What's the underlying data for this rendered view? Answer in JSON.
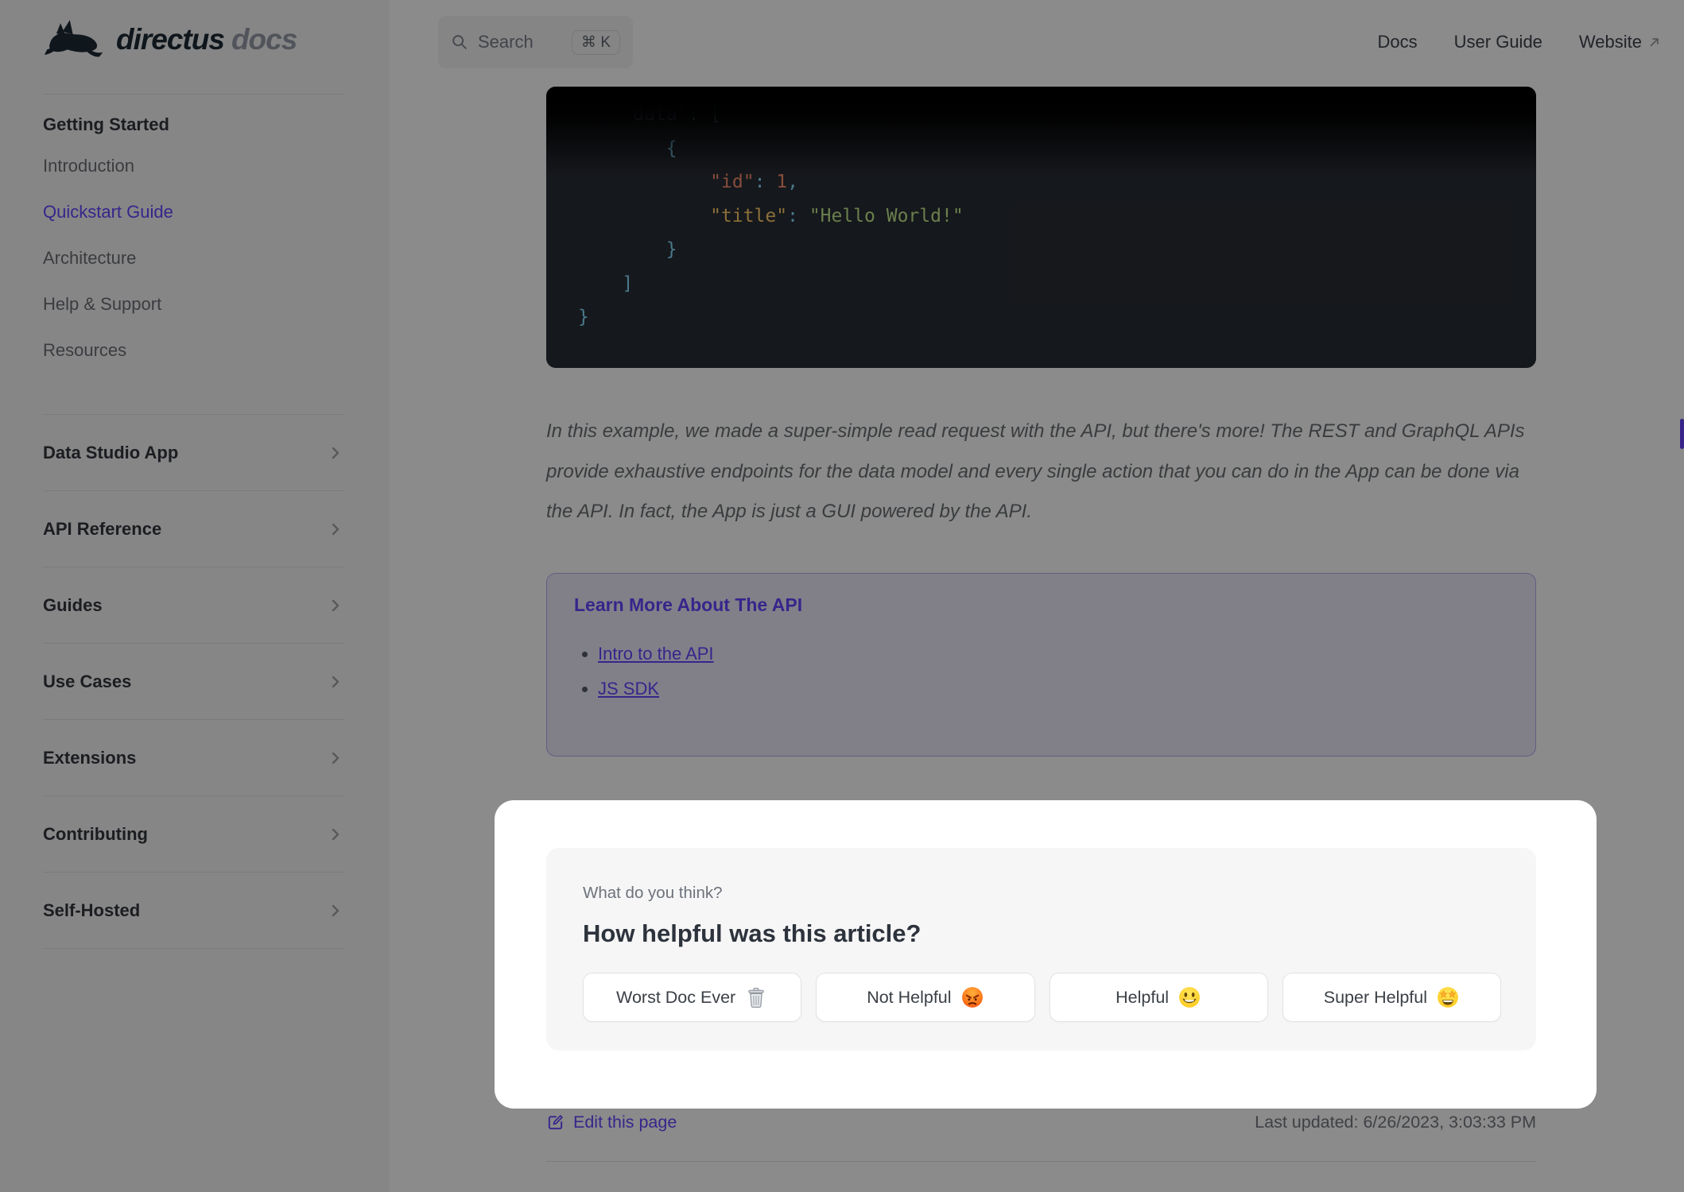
{
  "brand": {
    "name": "directus",
    "suffix": "docs"
  },
  "header": {
    "search": {
      "label": "Search",
      "shortcut": "⌘ K"
    },
    "nav": [
      {
        "label": "Docs"
      },
      {
        "label": "User Guide"
      },
      {
        "label": "Website",
        "external": true
      }
    ]
  },
  "sidebar": {
    "group_open": {
      "title": "Getting Started",
      "items": [
        "Introduction",
        "Quickstart Guide",
        "Architecture",
        "Help & Support",
        "Resources"
      ],
      "active_item": "Quickstart Guide"
    },
    "groups": [
      "Data Studio App",
      "API Reference",
      "Guides",
      "Use Cases",
      "Extensions",
      "Contributing",
      "Self-Hosted"
    ]
  },
  "code_block": {
    "language": "json",
    "lines": [
      {
        "tokens": [
          {
            "t": "    \"data\""
          },
          {
            "t": ": ["
          }
        ]
      },
      {
        "tokens": [
          {
            "t": "        {"
          }
        ]
      },
      {
        "tokens": [
          {
            "t": "            \"id\""
          },
          {
            "t": ": "
          },
          {
            "t": "1"
          },
          {
            "t": ","
          }
        ]
      },
      {
        "tokens": [
          {
            "t": "            \"title\""
          },
          {
            "t": ": "
          },
          {
            "t": "\"Hello World!\""
          }
        ]
      },
      {
        "tokens": [
          {
            "t": "        }"
          }
        ]
      },
      {
        "tokens": [
          {
            "t": "    ]"
          }
        ]
      },
      {
        "tokens": [
          {
            "t": "}"
          }
        ]
      }
    ]
  },
  "paragraph": "In this example, we made a super-simple read request with the API, but there's more! The REST and GraphQL APIs provide exhaustive endpoints for the data model and every single action that you can do in the App can be done via the API. In fact, the App is just a GUI powered by the API.",
  "callout": {
    "title": "Learn More About The API",
    "links": [
      "Intro to the API",
      "JS SDK"
    ]
  },
  "feedback": {
    "kicker": "What do you think?",
    "question": "How helpful was this article?",
    "options": [
      {
        "label": "Worst Doc Ever",
        "emoji": "🗑️",
        "icon": "trash-icon"
      },
      {
        "label": "Not Helpful",
        "emoji": "😠",
        "icon": "angry-face-icon"
      },
      {
        "label": "Helpful",
        "emoji": "😃",
        "icon": "smiley-face-icon"
      },
      {
        "label": "Super Helpful",
        "emoji": "🤩",
        "icon": "star-struck-icon"
      }
    ]
  },
  "footer": {
    "edit_label": "Edit this page",
    "last_updated": "Last updated: 6/26/2023, 3:03:33 PM"
  },
  "colors": {
    "accent": "#6644ff",
    "sidebar_bg": "#f6f6f7",
    "code_bg": "#282c34",
    "code_key_l1": "#c792ea",
    "code_key_l2": "#f78c6c",
    "code_key_l3": "#ffcb6b",
    "code_string": "#c3e88d",
    "code_punct": "#89ddff",
    "card_bg": "#f6f6f7"
  }
}
